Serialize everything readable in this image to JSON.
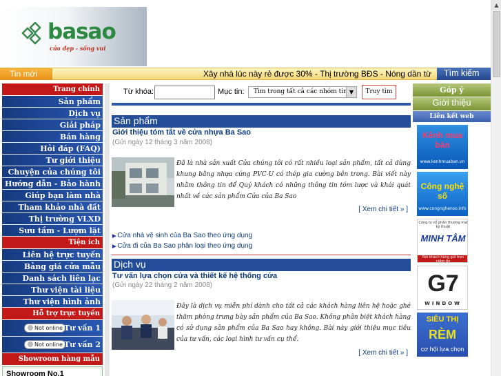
{
  "logo": {
    "text": "basao",
    "slogan": "cửa đẹp - sống vui"
  },
  "news": {
    "label": "Tin mới",
    "ticker": "Xây nhà lúc này rẻ được 30% - Thị trường BĐS - Nóng dần từ",
    "search_label": "Tìm kiếm"
  },
  "sidebar": {
    "main_header": "Trang chính",
    "main_items": [
      "Sản phẩm",
      "Dịch vụ",
      "Giải pháp",
      "Bán hàng",
      "Hỏi đáp (FAQ)",
      "Tư giới thiệu",
      "Chuyện của chúng tôi",
      "Hướng dẫn - Bảo hành",
      "Giúp bạn làm nhà",
      "Tham khảo nhà đất",
      "Thị trường VLXD",
      "Sưu tầm - Lượm lặt"
    ],
    "util_header": "Tiện ích",
    "util_items": [
      "Liên hệ trực tuyến",
      "Bảng giá cửa mẫu",
      "Danh sách liên lạc",
      "Thư viện tài liệu",
      "Thư viện hình ảnh"
    ],
    "support_header": "Hỗ trợ trực tuyến",
    "support": [
      {
        "status": "Not online",
        "label": "Tư vấn 1"
      },
      {
        "status": "Not online",
        "label": "Tư vấn 2"
      }
    ],
    "showroom_header": "Showroom hàng mẫu",
    "showroom_item": "Showroom No.1"
  },
  "search": {
    "keyword_label": "Từ khóa:",
    "keyword_value": "",
    "category_label": "Mục tin:",
    "category_value": "Tìm trong tất cả các nhóm tin",
    "button": "Truy tìm"
  },
  "sections": [
    {
      "title": "Sản phẩm",
      "article_title": "Giới thiệu tóm tắt về cửa nhựa Ba Sao",
      "date": "(Gửi ngày 12 tháng 3 năm 2008)",
      "summary": "Đã là nhà sản xuất Cửa chúng tôi có rất nhiều loại sản phẩm, tất cả dùng khung bằng nhựa cứng PVC-U có thép gia cường bên trong. Bài viết này nhằm thông tin để Quý khách có những thông tin tóm lược và khái quát nhất về các sản phẩm Cửa của Ba Sao",
      "more": "Xem chi tiết »",
      "links": [
        "Cửa nhà vệ sinh của Ba Sao theo ứng dụng",
        "Cửa đi của Ba Sao phân loại theo ứng dụng"
      ]
    },
    {
      "title": "Dịch vụ",
      "article_title": "Tư vấn lựa chọn cửa và thiết kế hệ thống cửa",
      "date": "(Gửi ngày 22 tháng 2 năm 2008)",
      "summary": "Đây là dịch vụ miễn phí dành cho tất cả các khách hàng liên hệ hoặc ghé thăm phòng trưng bày sản phẩm của Ba Sao. Không phân biệt khách hàng có sử dụng sản phẩm của Ba Sao hay không. Bài này giới thiệu mục tiêu của tư vấn, các loại hình tư vấn cụ thể.",
      "more": "Xem chi tiết »"
    }
  ],
  "right": {
    "buttons": [
      "Góp ý",
      "Giới thiệu"
    ],
    "links_header": "Liên kết web",
    "ads": [
      {
        "title": "Kênh mua bán",
        "url": "www.kenhmuaban.vn"
      },
      {
        "title": "Công nghệ số",
        "url": "www.congnghenso.info"
      },
      {
        "top": "Công ty cổ phần thương mại kỹ thuật",
        "title": "MINH TÂM",
        "sub": "Nơi khách hàng gửi trọn niềm tin"
      },
      {
        "title": "G7",
        "sub": "WINDOW"
      },
      {
        "title": "SIÊU THỊ",
        "title2": "RÈM",
        "sub": "cơ hội lựa chọn"
      }
    ]
  },
  "colors": {
    "nav": "#1e4896",
    "header_red": "#c21818",
    "section_blue": "#234d98",
    "link": "#0c3a7a",
    "green_btn": "#8aa03f"
  }
}
